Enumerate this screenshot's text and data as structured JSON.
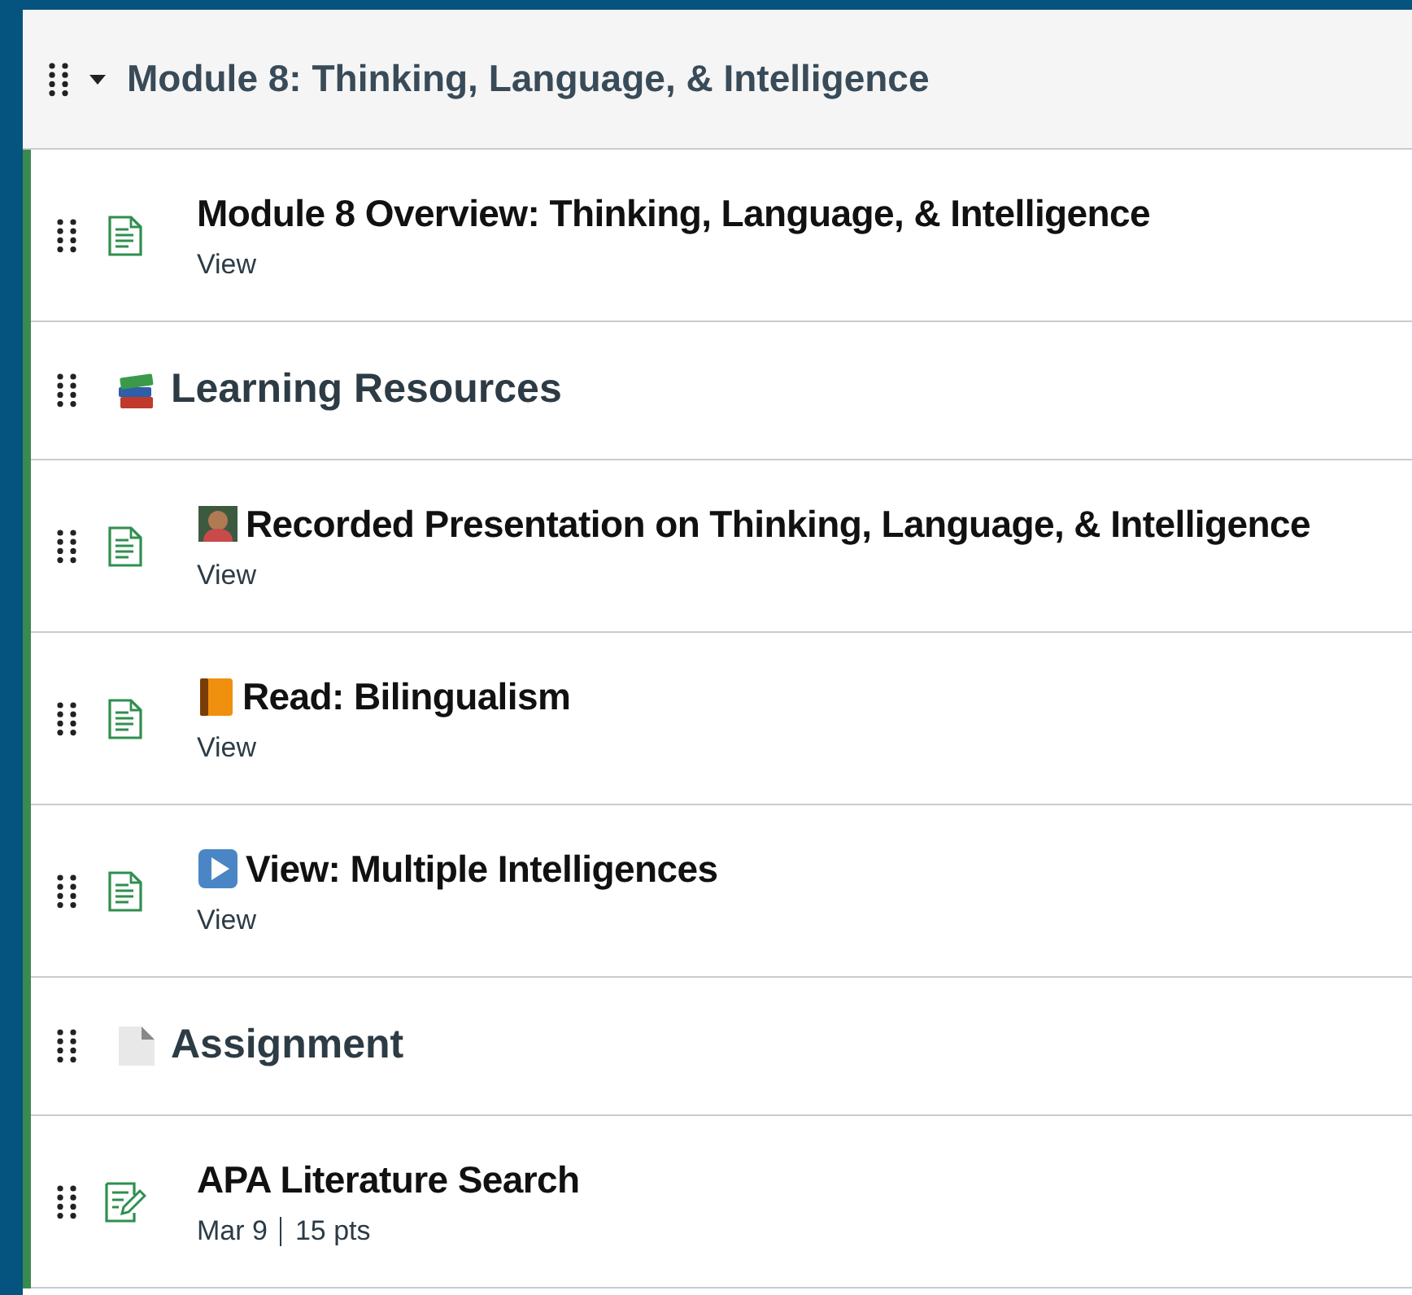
{
  "module": {
    "title": "Module 8: Thinking, Language, & Intelligence",
    "expanded": true,
    "items": [
      {
        "kind": "page",
        "title": "Module 8 Overview: Thinking, Language, & Intelligence",
        "details": [
          "View"
        ]
      },
      {
        "kind": "subheader",
        "title": "Learning Resources"
      },
      {
        "kind": "page",
        "title": "Recorded Presentation on Thinking, Language, & Intelligence",
        "details": [
          "View"
        ]
      },
      {
        "kind": "page",
        "title": "Read: Bilingualism",
        "details": [
          "View"
        ]
      },
      {
        "kind": "page",
        "title": "View: Multiple Intelligences",
        "details": [
          "View"
        ]
      },
      {
        "kind": "subheader",
        "title": "Assignment"
      },
      {
        "kind": "assignment",
        "title": "APA Literature Search",
        "details": [
          "Mar 9",
          "15 pts"
        ]
      }
    ]
  }
}
